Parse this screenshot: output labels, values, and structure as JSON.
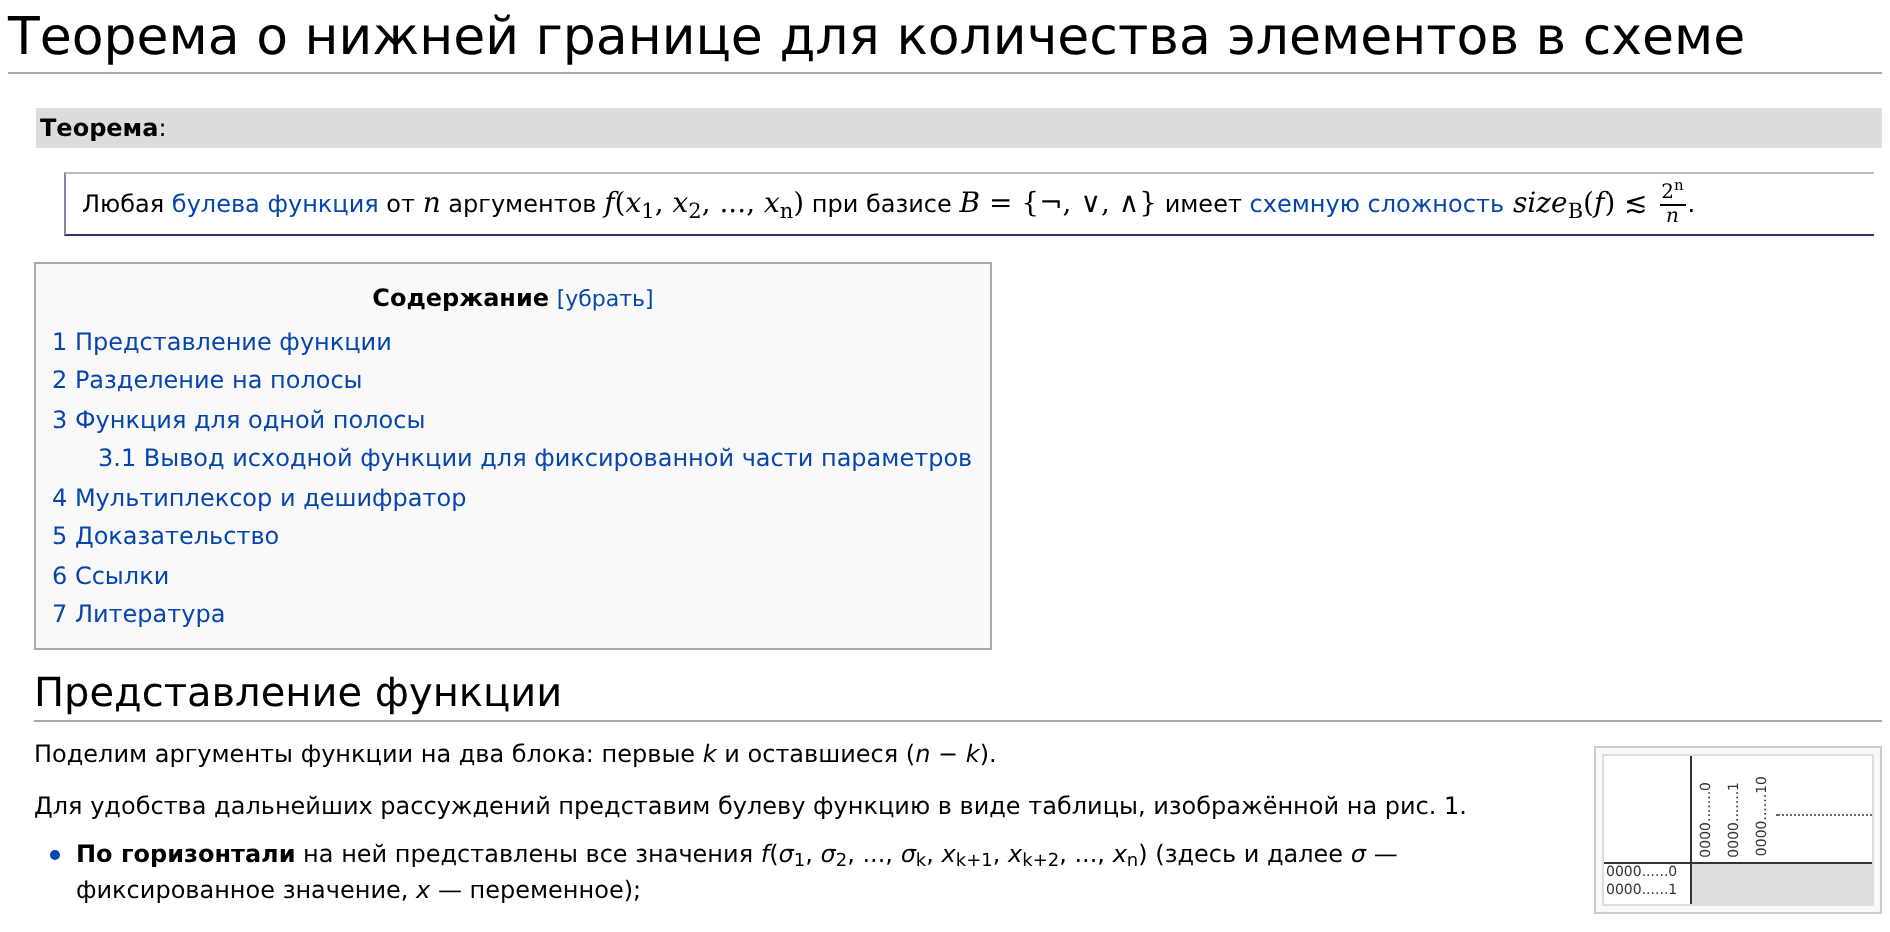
{
  "title": "Теорема о нижней границе для количества элементов в схеме",
  "theorem": {
    "label": "Теорема",
    "suffix": ":",
    "statement": [
      {
        "kind": "text",
        "text": "Любая "
      },
      {
        "kind": "link",
        "text": "булева функция"
      },
      {
        "kind": "text",
        "text": " от "
      },
      {
        "kind": "math",
        "text": "*n*"
      },
      {
        "kind": "text",
        "text": " аргументов "
      },
      {
        "kind": "math",
        "text": "*f*(*x*$_{1}$, *x*$_{2}$, ..., *x*$_{n}$)"
      },
      {
        "kind": "text",
        "text": " при базисе "
      },
      {
        "kind": "math",
        "text": "*B* = {¬, ∨, ∧}"
      },
      {
        "kind": "text",
        "text": " имеет "
      },
      {
        "kind": "link",
        "text": "схемную сложность"
      },
      {
        "kind": "math",
        "text": " *size*$_{B}$(*f*) ≲ "
      },
      {
        "kind": "frac",
        "num": "2$^{n}$",
        "den": "*n*"
      },
      {
        "kind": "text",
        "text": "."
      }
    ]
  },
  "toc": {
    "title": "Содержание",
    "toggle": "[убрать]",
    "items": [
      {
        "number": "1",
        "text": "Представление функции"
      },
      {
        "number": "2",
        "text": "Разделение на полосы"
      },
      {
        "number": "3",
        "text": "Функция для одной полосы",
        "children": [
          {
            "number": "3.1",
            "text": "Вывод исходной функции для фиксированной части параметров"
          }
        ]
      },
      {
        "number": "4",
        "text": "Мультиплексор и дешифратор"
      },
      {
        "number": "5",
        "text": "Доказательство"
      },
      {
        "number": "6",
        "text": "Ссылки"
      },
      {
        "number": "7",
        "text": "Литература"
      }
    ]
  },
  "section": {
    "heading": "Представление функции",
    "paragraphs": [
      "Поделим аргументы функции на два блока: первые *k* и оставшиеся (*n* − *k*).",
      "Для удобства дальнейших рассуждений представим булеву функцию в виде таблицы, изображённой на рис. 1."
    ],
    "bullets": [
      "**По горизонтали** на ней представлены все значения *f*(*σ*$_{1}$, *σ*$_{2}$, ..., *σ*$_{k}$, *x*$_{k+1}$, *x*$_{k+2}$, ..., *x*$_{n}$) (здесь и далее *σ* — фиксированное значение, *x* — переменное);"
    ]
  },
  "figure": {
    "columns": [
      "0000.......0",
      "0000.......1",
      "0000......10"
    ],
    "rows": [
      "0000......0",
      "0000......1"
    ]
  }
}
